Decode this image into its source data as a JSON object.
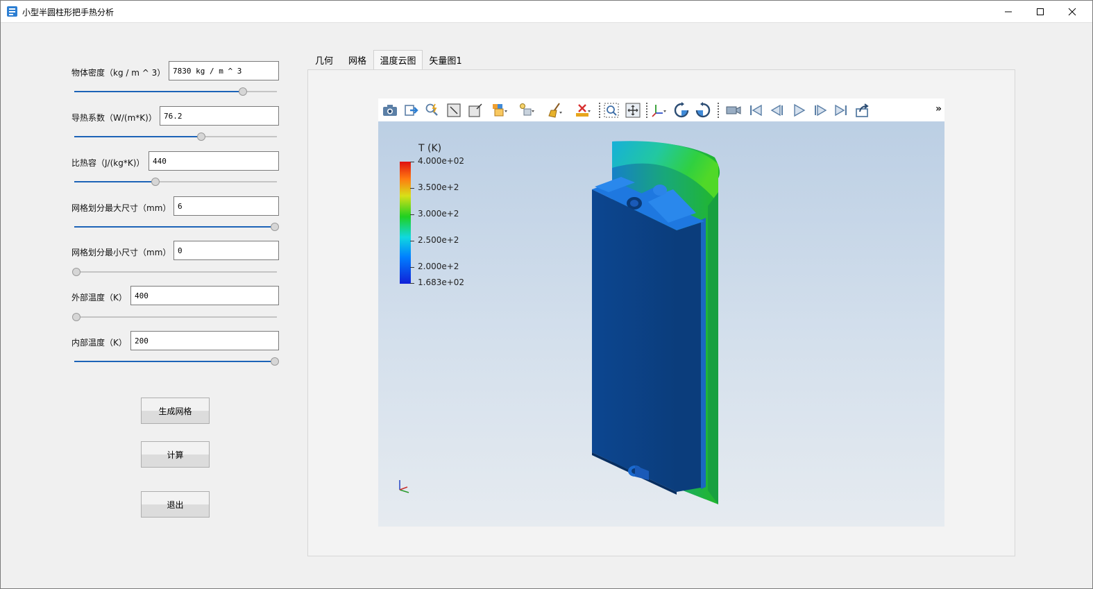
{
  "window": {
    "title": "小型半圆柱形把手热分析",
    "accent_color": "#1c63b7"
  },
  "params": [
    {
      "label": "物体密度（kg / m ^ 3）",
      "value": "7830 kg / m ^ 3",
      "slider_fraction": 0.84
    },
    {
      "label": "导热系数（W/(m*K)）",
      "value": "76.2",
      "slider_fraction": 0.63
    },
    {
      "label": "比热容（J/(kg*K)）",
      "value": "440",
      "slider_fraction": 0.4
    },
    {
      "label": "网格划分最大尺寸（mm）",
      "value": "6",
      "slider_fraction": 1.0
    },
    {
      "label": "网格划分最小尺寸（mm）",
      "value": "0",
      "slider_fraction": 0.0
    },
    {
      "label": "外部温度（K）",
      "value": "400",
      "slider_fraction": 0.0
    },
    {
      "label": "内部温度（K）",
      "value": "200",
      "slider_fraction": 1.0
    }
  ],
  "buttons": {
    "generate_mesh": "生成网格",
    "compute": "计算",
    "exit": "退出"
  },
  "tabs": [
    {
      "label": "几何",
      "active": false
    },
    {
      "label": "网格",
      "active": false
    },
    {
      "label": "温度云图",
      "active": true
    },
    {
      "label": "矢量图1",
      "active": false
    }
  ],
  "viewer": {
    "toolbar_icons": [
      "camera-icon",
      "export-icon",
      "zoom-interactive-icon",
      "zoom-fit-icon",
      "zoom-box-icon",
      "display-mode-icon",
      "lighting-icon",
      "clear-icon",
      "delete-icon",
      "zoom-region-icon",
      "fit-view-icon",
      "axes-orient-icon",
      "rotate-cw-icon",
      "rotate-ccw-icon",
      "record-icon",
      "first-frame-icon",
      "prev-frame-icon",
      "play-icon",
      "next-frame-icon",
      "last-frame-icon",
      "share-icon",
      "more-icon"
    ],
    "more_glyph": "»",
    "legend": {
      "title": "T (K)",
      "labels": [
        "4.000e+02",
        "3.500e+2",
        "3.000e+2",
        "2.500e+2",
        "2.000e+2",
        "1.683e+02"
      ]
    }
  }
}
